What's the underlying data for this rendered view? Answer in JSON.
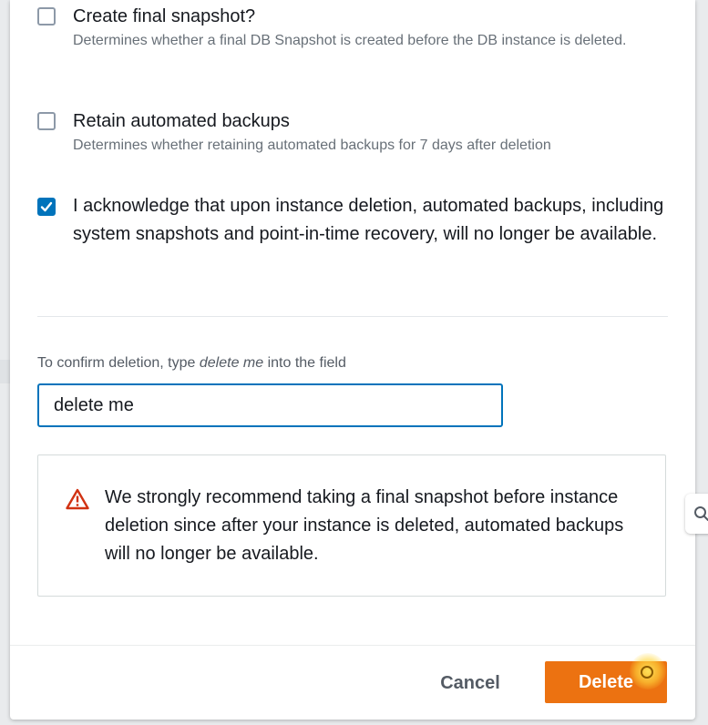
{
  "options": {
    "final_snapshot": {
      "label": "Create final snapshot?",
      "description": "Determines whether a final DB Snapshot is created before the DB instance is deleted.",
      "checked": false
    },
    "retain_backups": {
      "label": "Retain automated backups",
      "description": "Determines whether retaining automated backups for 7 days after deletion",
      "checked": false
    },
    "acknowledge": {
      "label": "I acknowledge that upon instance deletion, automated backups, including system snapshots and point-in-time recovery, will no longer be available.",
      "checked": true
    }
  },
  "confirm": {
    "label_prefix": "To confirm deletion, type ",
    "label_keyword": "delete me",
    "label_suffix": " into the field",
    "value": "delete me"
  },
  "alert": {
    "icon": "warning-triangle-icon",
    "text": "We strongly recommend taking a final snapshot before instance deletion since after your instance is deleted, automated backups will no longer be available."
  },
  "footer": {
    "cancel_label": "Cancel",
    "delete_label": "Delete"
  },
  "colors": {
    "primary": "#ec7211",
    "checkbox_checked": "#0073bb",
    "warning": "#d13212"
  }
}
